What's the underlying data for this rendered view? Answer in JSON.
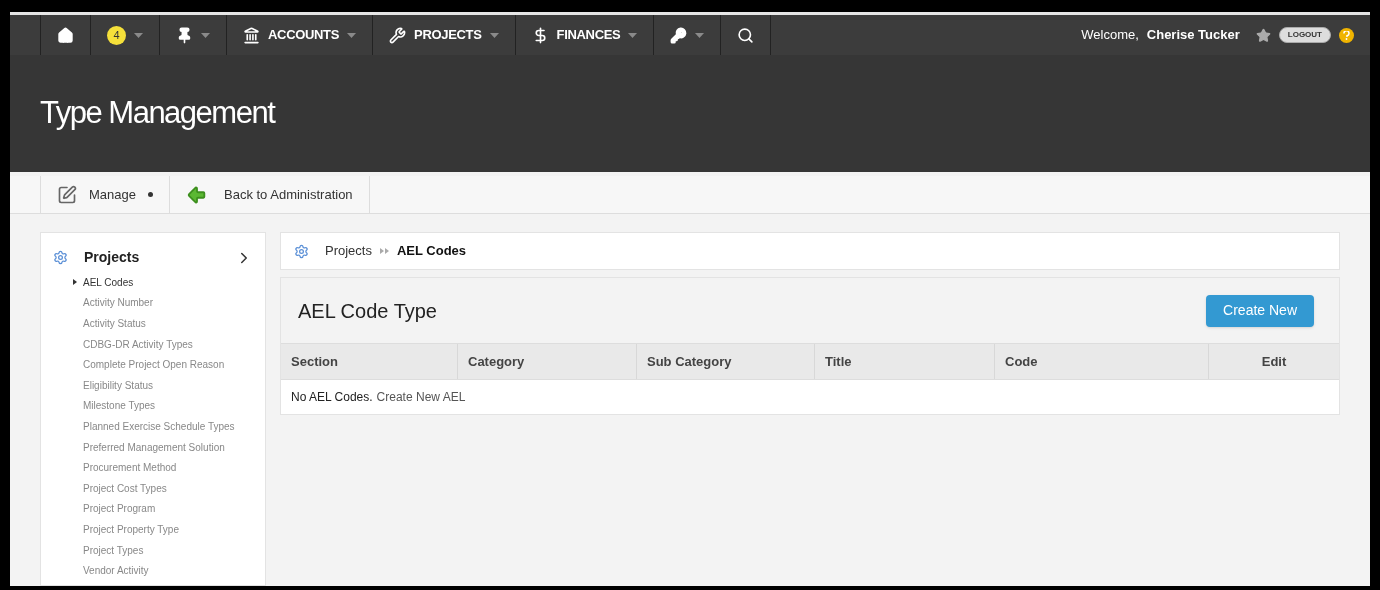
{
  "nav": {
    "items": [
      {
        "kind": "icon",
        "caret": false
      },
      {
        "kind": "badge",
        "label": "4",
        "caret": true
      },
      {
        "kind": "icon",
        "caret": true
      },
      {
        "kind": "label",
        "label": "ACCOUNTS",
        "caret": true
      },
      {
        "kind": "label",
        "label": "PROJECTS",
        "caret": true
      },
      {
        "kind": "label",
        "label": "FINANCES",
        "caret": true
      },
      {
        "kind": "icon",
        "caret": true
      },
      {
        "kind": "icon",
        "caret": false
      }
    ],
    "welcome": "Welcome,",
    "user": "Cherise Tucker",
    "logout": "LOGOUT"
  },
  "header": {
    "title": "Type Management"
  },
  "toolbar": {
    "manage": "Manage",
    "back": "Back to Administration"
  },
  "sidebar": {
    "title": "Projects",
    "items": [
      {
        "label": "AEL Codes",
        "selected": true
      },
      {
        "label": "Activity Number",
        "selected": false
      },
      {
        "label": "Activity Status",
        "selected": false
      },
      {
        "label": "CDBG-DR Activity Types",
        "selected": false
      },
      {
        "label": "Complete Project Open Reason",
        "selected": false
      },
      {
        "label": "Eligibility Status",
        "selected": false
      },
      {
        "label": "Milestone Types",
        "selected": false
      },
      {
        "label": "Planned Exercise Schedule Types",
        "selected": false
      },
      {
        "label": "Preferred Management Solution",
        "selected": false
      },
      {
        "label": "Procurement Method",
        "selected": false
      },
      {
        "label": "Project Cost Types",
        "selected": false
      },
      {
        "label": "Project Program",
        "selected": false
      },
      {
        "label": "Project Property Type",
        "selected": false
      },
      {
        "label": "Project Types",
        "selected": false
      },
      {
        "label": "Vendor Activity",
        "selected": false
      }
    ]
  },
  "breadcrumb": [
    "Projects",
    "AEL Codes"
  ],
  "panel": {
    "title": "AEL Code Type",
    "create_button": "Create New"
  },
  "table": {
    "columns": [
      "Section",
      "Category",
      "Sub Category",
      "Title",
      "Code",
      "Edit"
    ],
    "empty_message": "No AEL Codes.",
    "empty_link": "Create New AEL"
  }
}
